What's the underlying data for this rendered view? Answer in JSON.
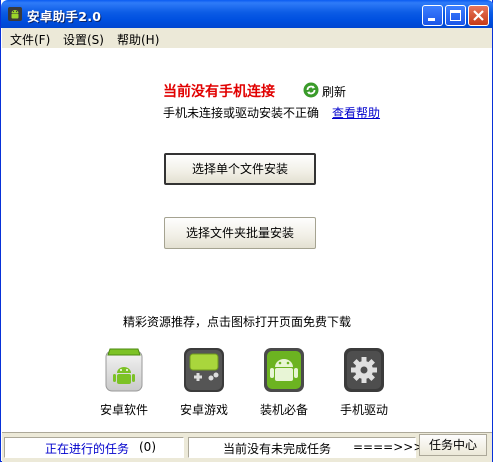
{
  "window": {
    "title": "安卓助手2.0"
  },
  "menu": {
    "items": [
      {
        "label": "文件(F)"
      },
      {
        "label": "设置(S)"
      },
      {
        "label": "帮助(H)"
      }
    ]
  },
  "connection": {
    "status": "当前没有手机连接",
    "refresh_label": "刷新",
    "hint": "手机未连接或驱动安装不正确",
    "help_link": "查看帮助"
  },
  "actions": {
    "install_single": "选择单个文件安装",
    "install_folder": "选择文件夹批量安装"
  },
  "recommend": {
    "text": "精彩资源推荐，点击图标打开页面免费下载",
    "apps": [
      {
        "label": "安卓软件",
        "icon": "android-box-icon"
      },
      {
        "label": "安卓游戏",
        "icon": "gameboy-icon"
      },
      {
        "label": "装机必备",
        "icon": "android-robot-icon"
      },
      {
        "label": "手机驱动",
        "icon": "gear-icon"
      }
    ]
  },
  "statusbar": {
    "running_tasks_label": "正在进行的任务",
    "running_tasks_count": "(0)",
    "pending_text": "当前没有未完成任务",
    "arrow_text": "====>>>",
    "task_center": "任务中心"
  },
  "colors": {
    "titlebar": "#0054e3",
    "status_red": "#e10000",
    "link_blue": "#0000cc",
    "android_green": "#7cc225"
  }
}
